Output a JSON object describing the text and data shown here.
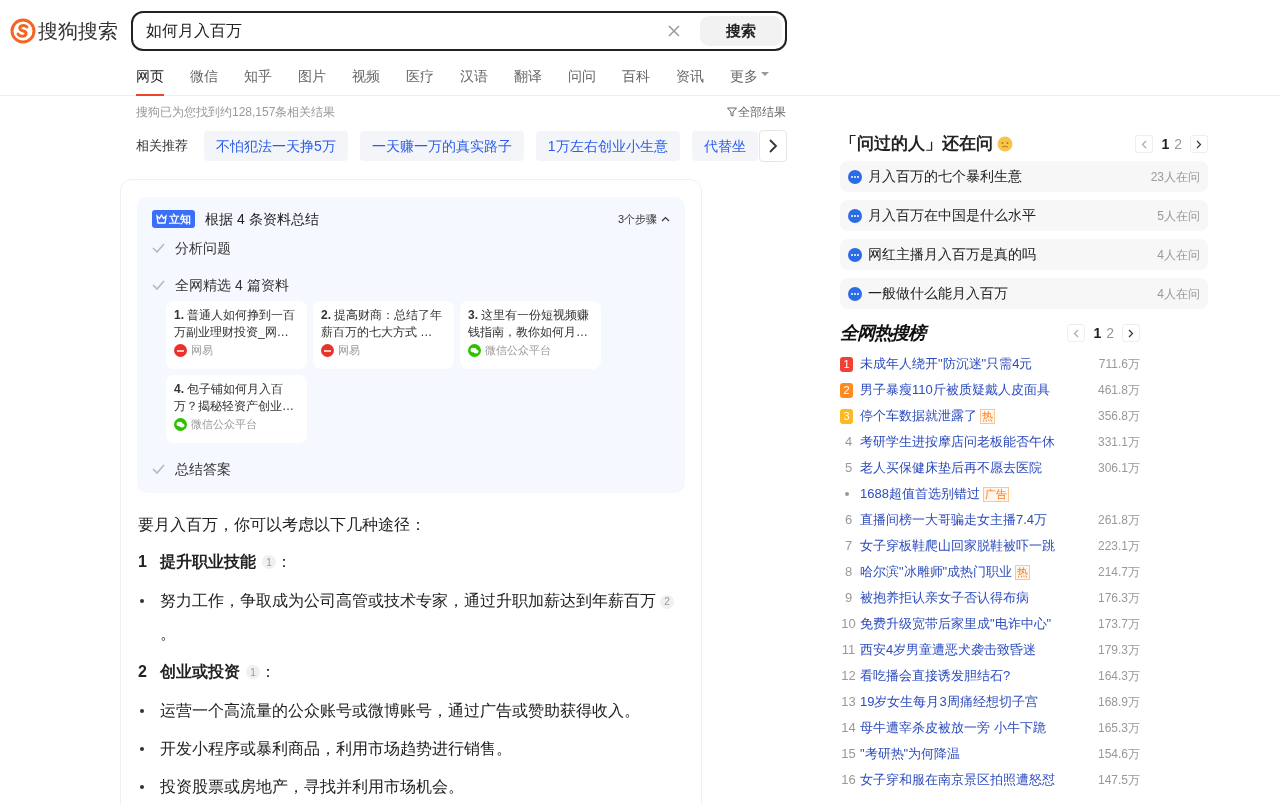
{
  "logo": {
    "text": "搜狗搜索"
  },
  "search": {
    "value": "如何月入百万",
    "button": "搜索"
  },
  "tabs": [
    {
      "label": "网页",
      "selected": true
    },
    {
      "label": "微信",
      "selected": false
    },
    {
      "label": "知乎",
      "selected": false
    },
    {
      "label": "图片",
      "selected": false
    },
    {
      "label": "视频",
      "selected": false
    },
    {
      "label": "医疗",
      "selected": false
    },
    {
      "label": "汉语",
      "selected": false
    },
    {
      "label": "翻译",
      "selected": false
    },
    {
      "label": "问问",
      "selected": false
    },
    {
      "label": "百科",
      "selected": false
    },
    {
      "label": "资讯",
      "selected": false
    },
    {
      "label": "更多",
      "selected": false,
      "dropdown": true
    }
  ],
  "result_count": "搜狗已为您找到约128,157条相关结果",
  "filter": "全部结果",
  "related": {
    "label": "相关推荐",
    "items": [
      "不怕犯法一天挣5万",
      "一天赚一万的真实路子",
      "1万左右创业小生意",
      "代替坐"
    ]
  },
  "summary": {
    "badge": "立知",
    "title": "根据 4 条资料总结",
    "steps_label": "3个步骤",
    "expanded": true,
    "steps": [
      {
        "label": "分析问题",
        "done": true
      },
      {
        "label": "全网精选 4 篇资料",
        "done": true,
        "sources": [
          {
            "title": "**1.** 普通人如何挣到一百万副业理财投资_网…",
            "source": "网易",
            "kind": "netease"
          },
          {
            "title": "**2.** 提高财商：总结了年薪百万的七大方式 …",
            "source": "网易",
            "kind": "netease"
          },
          {
            "title": "**3.** 这里有一份短视频赚钱指南，教你如何月…",
            "source": "微信公众平台",
            "kind": "wechat"
          },
          {
            "title": "**4.** 包子铺如何月入百万？揭秘轻资产创业…",
            "source": "微信公众平台",
            "kind": "wechat"
          }
        ]
      },
      {
        "label": "总结答案",
        "done": true
      }
    ]
  },
  "answer": {
    "intro": "要月入百万，你可以考虑以下几种途径：",
    "sections": [
      {
        "number": "1",
        "title": "提升职业技能",
        "cite": "1",
        "colon": "：",
        "bullets": [
          {
            "text": "努力工作，争取成为公司高管或技术专家，通过升职加薪达到年薪百万",
            "cite": "2",
            "tail": "。"
          }
        ]
      },
      {
        "number": "2",
        "title": "创业或投资",
        "cite": "1",
        "colon": "：",
        "bullets": [
          {
            "text": "运营一个高流量的公众账号或微博账号，通过广告或赞助获得收入。"
          },
          {
            "text": "开发小程序或暴利商品，利用市场趋势进行销售。"
          },
          {
            "text": "投资股票或房地产，寻找并利用市场机会。"
          }
        ]
      }
    ]
  },
  "asked": {
    "title": "「问过的人」还在问",
    "pages": [
      {
        "label": "1",
        "selected": true
      },
      {
        "label": "2",
        "selected": false
      }
    ],
    "items": [
      {
        "text": "月入百万的七个暴利生意",
        "count": "23人在问"
      },
      {
        "text": "月入百万在中国是什么水平",
        "count": "5人在问"
      },
      {
        "text": "网红主播月入百万是真的吗",
        "count": "4人在问"
      },
      {
        "text": "一般做什么能月入百万",
        "count": "4人在问"
      }
    ]
  },
  "hot": {
    "title": "全网热搜榜",
    "pages": [
      {
        "label": "1",
        "selected": true
      },
      {
        "label": "2",
        "selected": false
      }
    ],
    "items": [
      {
        "kind": "rank",
        "rank": "1",
        "color": "#f04134",
        "text": "未成年人绕开\"防沉迷\"只需4元",
        "value": "711.6万"
      },
      {
        "kind": "rank",
        "rank": "2",
        "color": "#ff8b1f",
        "text": "男子暴瘦110斤被质疑戴人皮面具",
        "value": "461.8万"
      },
      {
        "kind": "rank",
        "rank": "3",
        "color": "#ffb81f",
        "text": "停个车数据就泄露了",
        "tag": "热",
        "value": "356.8万"
      },
      {
        "kind": "rank",
        "rank": "4",
        "text": "考研学生进按摩店问老板能否午休",
        "value": "331.1万"
      },
      {
        "kind": "rank",
        "rank": "5",
        "text": "老人买保健床垫后再不愿去医院",
        "value": "306.1万"
      },
      {
        "kind": "ad",
        "text": "1688超值首选别错过",
        "tag": "广告"
      },
      {
        "kind": "rank",
        "rank": "6",
        "text": "直播间榜一大哥骗走女主播7.4万",
        "value": "261.8万"
      },
      {
        "kind": "rank",
        "rank": "7",
        "text": "女子穿板鞋爬山回家脱鞋被吓一跳",
        "value": "223.1万"
      },
      {
        "kind": "rank",
        "rank": "8",
        "text": "哈尔滨\"冰雕师\"成热门职业",
        "tag": "热",
        "value": "214.7万"
      },
      {
        "kind": "rank",
        "rank": "9",
        "text": "被抱养拒认亲女子否认得布病",
        "value": "176.3万"
      },
      {
        "kind": "rank",
        "rank": "10",
        "text": "免费升级宽带后家里成\"电诈中心\"",
        "value": "173.7万"
      },
      {
        "kind": "rank",
        "rank": "11",
        "text": "西安4岁男童遭恶犬袭击致昏迷",
        "value": "179.3万"
      },
      {
        "kind": "rank",
        "rank": "12",
        "text": "看吃播会直接诱发胆结石?",
        "value": "164.3万"
      },
      {
        "kind": "rank",
        "rank": "13",
        "text": "19岁女生每月3周痛经想切子宫",
        "value": "168.9万"
      },
      {
        "kind": "rank",
        "rank": "14",
        "text": "母牛遭宰杀皮被放一旁 小牛下跪",
        "value": "165.3万"
      },
      {
        "kind": "rank",
        "rank": "15",
        "text": "\"考研热\"为何降温",
        "value": "154.6万"
      },
      {
        "kind": "rank",
        "rank": "16",
        "text": "女子穿和服在南京景区拍照遭怒怼",
        "value": "147.5万"
      }
    ]
  }
}
